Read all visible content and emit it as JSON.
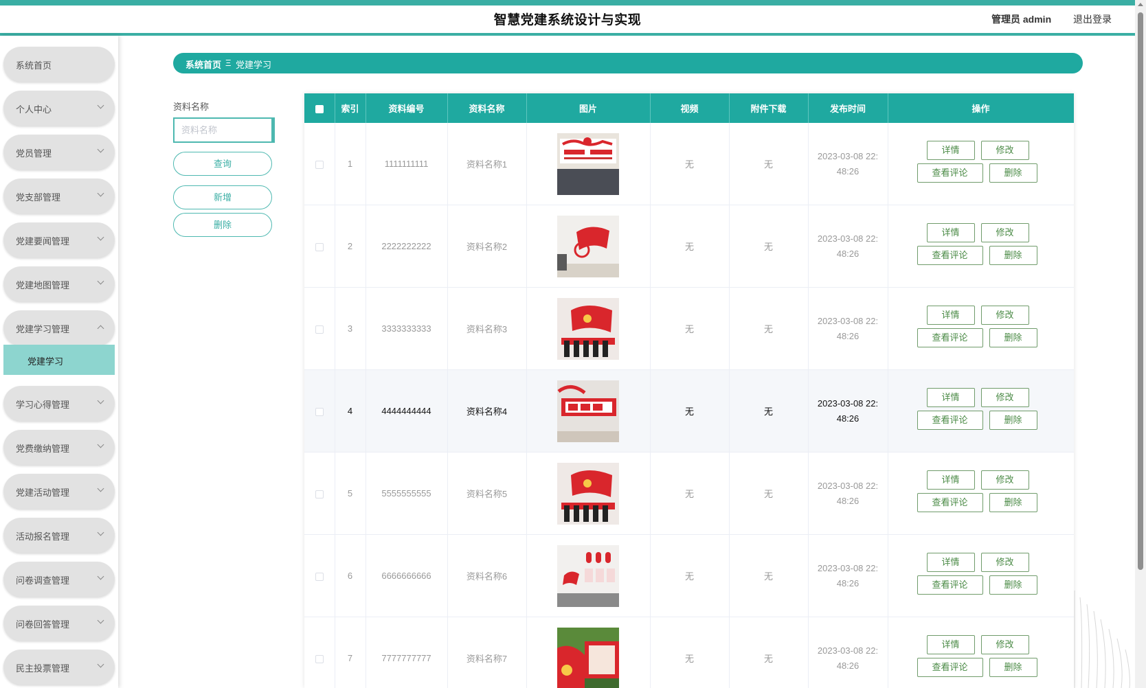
{
  "header": {
    "title": "智慧党建系统设计与实现",
    "admin": "管理员 admin",
    "logout": "退出登录"
  },
  "sidebar": {
    "items": [
      {
        "label": "系统首页"
      },
      {
        "label": "个人中心"
      },
      {
        "label": "党员管理"
      },
      {
        "label": "党支部管理"
      },
      {
        "label": "党建要闻管理"
      },
      {
        "label": "党建地图管理"
      },
      {
        "label": "党建学习管理"
      },
      {
        "label": "学习心得管理"
      },
      {
        "label": "党费缴纳管理"
      },
      {
        "label": "党建活动管理"
      },
      {
        "label": "活动报名管理"
      },
      {
        "label": "问卷调查管理"
      },
      {
        "label": "问卷回答管理"
      },
      {
        "label": "民主投票管理"
      }
    ],
    "active_sub": "党建学习"
  },
  "breadcrumb": {
    "home": "系统首页",
    "separator": "Ξ",
    "current": "党建学习"
  },
  "search": {
    "label": "资料名称",
    "placeholder": "资料名称",
    "query_btn": "查询",
    "add_btn": "新增",
    "delete_btn": "删除"
  },
  "table": {
    "headers": [
      "",
      "索引",
      "资料编号",
      "资料名称",
      "图片",
      "视频",
      "附件下载",
      "发布时间",
      "操作"
    ],
    "buttons": {
      "detail": "详情",
      "edit": "修改",
      "comments": "查看评论",
      "delete": "删除"
    },
    "rows": [
      {
        "index": "1",
        "code": "1111111111",
        "name": "资料名称1",
        "video": "无",
        "attachment": "无",
        "time_a": "2023-03-08 22:",
        "time_b": "48:26"
      },
      {
        "index": "2",
        "code": "2222222222",
        "name": "资料名称2",
        "video": "无",
        "attachment": "无",
        "time_a": "2023-03-08 22:",
        "time_b": "48:26"
      },
      {
        "index": "3",
        "code": "3333333333",
        "name": "资料名称3",
        "video": "无",
        "attachment": "无",
        "time_a": "2023-03-08 22:",
        "time_b": "48:26"
      },
      {
        "index": "4",
        "code": "4444444444",
        "name": "资料名称4",
        "video": "无",
        "attachment": "无",
        "time_a": "2023-03-08 22:",
        "time_b": "48:26"
      },
      {
        "index": "5",
        "code": "5555555555",
        "name": "资料名称5",
        "video": "无",
        "attachment": "无",
        "time_a": "2023-03-08 22:",
        "time_b": "48:26"
      },
      {
        "index": "6",
        "code": "6666666666",
        "name": "资料名称6",
        "video": "无",
        "attachment": "无",
        "time_a": "2023-03-08 22:",
        "time_b": "48:26"
      },
      {
        "index": "7",
        "code": "7777777777",
        "name": "资料名称7",
        "video": "无",
        "attachment": "无",
        "time_a": "2023-03-08 22:",
        "time_b": "48:26"
      }
    ]
  },
  "colors": {
    "accent": "#1fa9a0",
    "accent_light": "#8dd5cf",
    "button_green": "#4a8a45",
    "hero_red": "#d9262c"
  }
}
